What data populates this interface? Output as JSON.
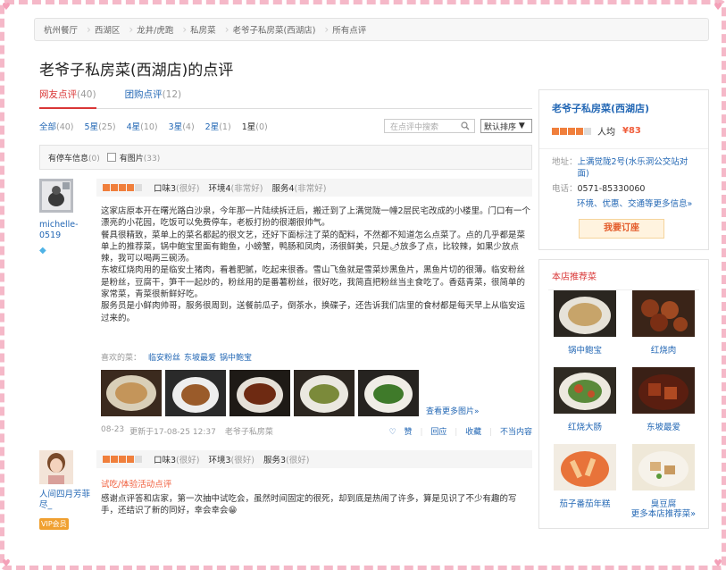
{
  "breadcrumb": [
    "杭州餐厅",
    "西湖区",
    "龙井/虎跑",
    "私房菜",
    "老爷子私房菜(西湖店)",
    "所有点评"
  ],
  "page_title": "老爷子私房菜(西湖店)的点评",
  "tabs": [
    {
      "label": "网友点评",
      "count": "(40)"
    },
    {
      "label": "团购点评",
      "count": "(12)"
    }
  ],
  "filters": [
    {
      "label": "全部",
      "count": "(40)"
    },
    {
      "label": "5星",
      "count": "(25)"
    },
    {
      "label": "4星",
      "count": "(10)"
    },
    {
      "label": "3星",
      "count": "(4)"
    },
    {
      "label": "2星",
      "count": "(1)"
    },
    {
      "label": "1星",
      "count": "(0)"
    }
  ],
  "search_placeholder": "在点评中搜索",
  "sort_label": "默认排序",
  "options": {
    "parking": "有停车信息",
    "parking_count": "(0)",
    "photos": "有图片",
    "photos_count": "(33)"
  },
  "reviews": [
    {
      "user": "michelle-0519",
      "stars": 4,
      "scores": [
        {
          "label": "口味3",
          "note": "(很好)"
        },
        {
          "label": "环境4",
          "note": "(非常好)"
        },
        {
          "label": "服务4",
          "note": "(非常好)"
        }
      ],
      "text": "这家店原本开在曙光路白沙泉，今年那一片陆续拆迁后，搬迁到了上满觉陇一幢2层民宅改成的小楼里。门口有一个漂亮的小花园，吃饭可以免费停车，老板打扮的很潮很帅气。\n餐具很精致，菜单上的菜名都起的很文艺，还好下面标注了菜的配料，不然都不知道怎么点菜了。点的几乎都是菜单上的推荐菜，锅中鲍宝里面有鲍鱼，小螃蟹，鸭肠和凤肉，汤很鲜美，只是🌶放多了点，比较辣，如果少放点辣，我可以喝两三碗汤。\n东坡红烧肉用的是临安土猪肉，看着肥腻，吃起来很香。雪山飞鱼就是雪菜炒黑鱼片，黑鱼片切的很薄。临安粉丝是粉丝，豆腐干，笋干一起炒的，粉丝用的是番薯粉丝，很好吃，我简直把粉丝当主食吃了。香菇青菜，很简单的家常菜，青菜很新鲜好吃。\n服务员是小鲜肉帅哥，服务很周到，送餐前瓜子，倒茶水，换碟子，还告诉我们店里的食材都是每天早上从临安运过来的。",
      "likes_label": "喜欢的菜：",
      "likes": [
        "临安粉丝",
        "东坡最爱",
        "锅中鲍宝"
      ],
      "more_photos": "查看更多图片»",
      "date": "08-23",
      "updated": "更新于17-08-25 12:37",
      "shop": "老爷子私房菜",
      "actions": [
        "赞",
        "回应",
        "收藏",
        "不当内容"
      ]
    },
    {
      "user": "人间四月芳菲尽_",
      "badge": "VIP会员",
      "stars": 4,
      "scores": [
        {
          "label": "口味3",
          "note": "(很好)"
        },
        {
          "label": "环境3",
          "note": "(很好)"
        },
        {
          "label": "服务3",
          "note": "(很好)"
        }
      ],
      "tag": "试吃/体验活动点评",
      "text": "感谢点评答和店家，第一次抽中试吃会，虽然时间固定的很死，却到底是热闹了许多，算是见识了不少有趣的写手，还结识了新的同好，幸会幸会😁"
    }
  ],
  "shop": {
    "name": "老爷子私房菜(西湖店)",
    "stars": 4,
    "avg_label": "人均",
    "avg_price": "¥83",
    "address_label": "地址：",
    "address": "上满觉陇2号(水乐洞公交站对面)",
    "phone_label": "电话：",
    "phone": "0571-85330060",
    "more_info": "环境、优惠、交通等更多信息»",
    "book": "我要订座"
  },
  "recommend": {
    "title": "本店推荐菜",
    "dishes": [
      "锅中鲍宝",
      "红烧肉",
      "红烧大肠",
      "东坡最爱",
      "茄子番茄年糕",
      "臭豆腐"
    ],
    "more": "更多本店推荐菜»"
  },
  "colors": {
    "link": "#2468b5",
    "accent": "#d93636",
    "star": "#f07f3c",
    "frame": "#f5b8c8"
  }
}
